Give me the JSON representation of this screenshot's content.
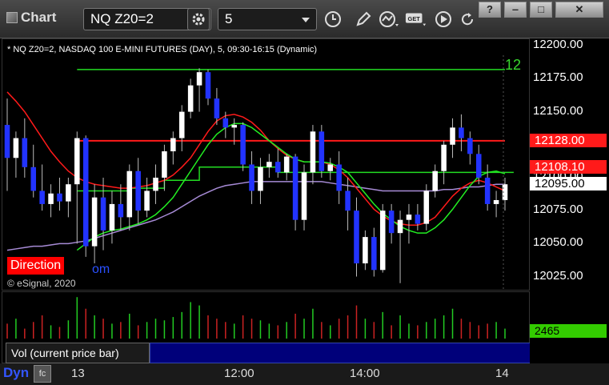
{
  "window": {
    "title": "Chart",
    "symbol_value": "NQ Z20=2",
    "interval_value": "5",
    "buttons": {
      "help": "?",
      "minimize": "‒",
      "maximize": "□",
      "close": "✕"
    }
  },
  "toolbar_icons": [
    "gear-icon",
    "clock-icon",
    "pencil-icon",
    "study-icon",
    "get-icon",
    "play-icon",
    "refresh-icon"
  ],
  "chart": {
    "info_line": "* NQ Z20=2, NASDAQ 100 E-MINI FUTURES (DAY), 5, 09:30-16:15 (Dynamic)",
    "copyright": "© eSignal, 2020",
    "direction_label": "Direction",
    "direction_tail": "om",
    "green_level_label": "12",
    "price_ticks": [
      "12200.00",
      "12175.00",
      "12150.00",
      "12125.00",
      "12100.00",
      "12075.00",
      "12050.00",
      "12025.00"
    ],
    "price_tags": [
      {
        "label": "12128.00",
        "color": "#ff1a1a"
      },
      {
        "label": "12108.10",
        "color": "#ff1a1a"
      },
      {
        "label": "12095.00",
        "color": "#ffffff"
      }
    ],
    "time_ticks": [
      "13",
      "12:00",
      "14:00",
      "14"
    ]
  },
  "volume": {
    "legend": "Vol (current price bar)",
    "close": "×",
    "value": "2465"
  },
  "bottom": {
    "dyn_label": "Dyn",
    "dyn_icon": "fc"
  },
  "chart_data": {
    "type": "candlestick",
    "ylim": [
      12015,
      12205
    ],
    "candles": [
      {
        "o": 12140,
        "h": 12160,
        "l": 12090,
        "c": 12115
      },
      {
        "o": 12115,
        "h": 12135,
        "l": 12100,
        "c": 12130
      },
      {
        "o": 12130,
        "h": 12145,
        "l": 12100,
        "c": 12108
      },
      {
        "o": 12108,
        "h": 12125,
        "l": 12085,
        "c": 12090
      },
      {
        "o": 12090,
        "h": 12110,
        "l": 12075,
        "c": 12080
      },
      {
        "o": 12080,
        "h": 12095,
        "l": 12070,
        "c": 12088
      },
      {
        "o": 12088,
        "h": 12100,
        "l": 12075,
        "c": 12082
      },
      {
        "o": 12082,
        "h": 12100,
        "l": 12070,
        "c": 12095
      },
      {
        "o": 12095,
        "h": 12135,
        "l": 12050,
        "c": 12130
      },
      {
        "o": 12130,
        "h": 12132,
        "l": 12040,
        "c": 12048
      },
      {
        "o": 12048,
        "h": 12095,
        "l": 12035,
        "c": 12085
      },
      {
        "o": 12085,
        "h": 12100,
        "l": 12045,
        "c": 12060
      },
      {
        "o": 12060,
        "h": 12090,
        "l": 12050,
        "c": 12080
      },
      {
        "o": 12080,
        "h": 12095,
        "l": 12060,
        "c": 12070
      },
      {
        "o": 12070,
        "h": 12110,
        "l": 12060,
        "c": 12105
      },
      {
        "o": 12105,
        "h": 12115,
        "l": 12065,
        "c": 12075
      },
      {
        "o": 12075,
        "h": 12100,
        "l": 12070,
        "c": 12090
      },
      {
        "o": 12090,
        "h": 12110,
        "l": 12080,
        "c": 12100
      },
      {
        "o": 12100,
        "h": 12125,
        "l": 12090,
        "c": 12120
      },
      {
        "o": 12120,
        "h": 12135,
        "l": 12110,
        "c": 12130
      },
      {
        "o": 12130,
        "h": 12155,
        "l": 12120,
        "c": 12150
      },
      {
        "o": 12150,
        "h": 12175,
        "l": 12145,
        "c": 12170
      },
      {
        "o": 12170,
        "h": 12183,
        "l": 12150,
        "c": 12180
      },
      {
        "o": 12180,
        "h": 12182,
        "l": 12155,
        "c": 12160
      },
      {
        "o": 12160,
        "h": 12168,
        "l": 12140,
        "c": 12145
      },
      {
        "o": 12145,
        "h": 12150,
        "l": 12130,
        "c": 12138
      },
      {
        "o": 12138,
        "h": 12145,
        "l": 12125,
        "c": 12140
      },
      {
        "o": 12140,
        "h": 12142,
        "l": 12105,
        "c": 12110
      },
      {
        "o": 12110,
        "h": 12120,
        "l": 12080,
        "c": 12090
      },
      {
        "o": 12090,
        "h": 12115,
        "l": 12080,
        "c": 12108
      },
      {
        "o": 12108,
        "h": 12118,
        "l": 12100,
        "c": 12112
      },
      {
        "o": 12112,
        "h": 12122,
        "l": 12100,
        "c": 12104
      },
      {
        "o": 12104,
        "h": 12118,
        "l": 12098,
        "c": 12116
      },
      {
        "o": 12116,
        "h": 12118,
        "l": 12060,
        "c": 12068
      },
      {
        "o": 12068,
        "h": 12110,
        "l": 12060,
        "c": 12104
      },
      {
        "o": 12104,
        "h": 12140,
        "l": 12095,
        "c": 12135
      },
      {
        "o": 12135,
        "h": 12140,
        "l": 12100,
        "c": 12105
      },
      {
        "o": 12105,
        "h": 12115,
        "l": 12098,
        "c": 12110
      },
      {
        "o": 12110,
        "h": 12120,
        "l": 12080,
        "c": 12090
      },
      {
        "o": 12090,
        "h": 12100,
        "l": 12060,
        "c": 12075
      },
      {
        "o": 12075,
        "h": 12085,
        "l": 12025,
        "c": 12035
      },
      {
        "o": 12035,
        "h": 12060,
        "l": 12030,
        "c": 12055
      },
      {
        "o": 12055,
        "h": 12062,
        "l": 12025,
        "c": 12030
      },
      {
        "o": 12030,
        "h": 12080,
        "l": 12028,
        "c": 12075
      },
      {
        "o": 12075,
        "h": 12080,
        "l": 12050,
        "c": 12058
      },
      {
        "o": 12058,
        "h": 12075,
        "l": 12020,
        "c": 12068
      },
      {
        "o": 12068,
        "h": 12080,
        "l": 12050,
        "c": 12072
      },
      {
        "o": 12072,
        "h": 12080,
        "l": 12060,
        "c": 12065
      },
      {
        "o": 12065,
        "h": 12095,
        "l": 12060,
        "c": 12090
      },
      {
        "o": 12090,
        "h": 12110,
        "l": 12085,
        "c": 12105
      },
      {
        "o": 12105,
        "h": 12128,
        "l": 12095,
        "c": 12125
      },
      {
        "o": 12125,
        "h": 12145,
        "l": 12115,
        "c": 12138
      },
      {
        "o": 12138,
        "h": 12148,
        "l": 12120,
        "c": 12130
      },
      {
        "o": 12130,
        "h": 12135,
        "l": 12110,
        "c": 12118
      },
      {
        "o": 12118,
        "h": 12125,
        "l": 12095,
        "c": 12100
      },
      {
        "o": 12100,
        "h": 12110,
        "l": 12075,
        "c": 12080
      },
      {
        "o": 12080,
        "h": 12090,
        "l": 12070,
        "c": 12083
      },
      {
        "o": 12083,
        "h": 12100,
        "l": 12075,
        "c": 12095
      }
    ],
    "red_ma": [
      12165,
      12158,
      12150,
      12140,
      12130,
      12120,
      12112,
      12105,
      12100,
      12097,
      12095,
      12094,
      12093,
      12092,
      12092,
      12093,
      12094,
      12096,
      12098,
      12102,
      12108,
      12115,
      12125,
      12135,
      12143,
      12147,
      12148,
      12146,
      12142,
      12136,
      12128,
      12122,
      12117,
      12114,
      12112,
      12112,
      12112,
      12110,
      12106,
      12100,
      12092,
      12084,
      12076,
      12071,
      12067,
      12065,
      12064,
      12064,
      12066,
      12070,
      12078,
      12086,
      12092,
      12096,
      12098,
      12096,
      12093,
      12090
    ],
    "green_ma": [
      null,
      null,
      null,
      null,
      null,
      null,
      null,
      null,
      12045,
      12050,
      12055,
      12058,
      12060,
      12061,
      12063,
      12065,
      12068,
      12072,
      12078,
      12085,
      12095,
      12105,
      12115,
      12125,
      12133,
      12138,
      12141,
      12141,
      12138,
      12133,
      12128,
      12123,
      12118,
      12114,
      12112,
      12112,
      12112,
      12111,
      12108,
      12104,
      12096,
      12088,
      12080,
      12073,
      12068,
      12063,
      12060,
      12058,
      12058,
      12062,
      12068,
      12076,
      12085,
      12094,
      12101,
      12104,
      12105,
      12103
    ],
    "purple_ma": [
      12045,
      12046,
      12047,
      12048,
      12048,
      12049,
      12050,
      12050,
      12051,
      12052,
      12054,
      12056,
      12058,
      12060,
      12062,
      12064,
      12066,
      12068,
      12071,
      12074,
      12078,
      12082,
      12086,
      12089,
      12092,
      12094,
      12095,
      12096,
      12097,
      12097,
      12097,
      12097,
      12097,
      12097,
      12097,
      12097,
      12097,
      12096,
      12095,
      12094,
      12093,
      12092,
      12091,
      12090,
      12090,
      12090,
      12090,
      12090,
      12090,
      12090,
      12091,
      12091,
      12092,
      12093,
      12093,
      12094,
      12095,
      12095
    ],
    "green_hline": {
      "value": 12182,
      "start_index": 8
    },
    "red_hline": {
      "value": 12128,
      "start_index": 8
    },
    "green_step": [
      {
        "from": 8,
        "to": 14,
        "value": 12090
      },
      {
        "from": 14,
        "to": 18,
        "value": 12092
      },
      {
        "from": 18,
        "to": 22,
        "value": 12098
      },
      {
        "from": 22,
        "to": 31,
        "value": 12108
      },
      {
        "from": 31,
        "to": 58,
        "value": 12104
      }
    ],
    "volume": [
      9,
      12,
      6,
      10,
      14,
      8,
      7,
      11,
      25,
      18,
      14,
      12,
      9,
      10,
      15,
      8,
      10,
      12,
      11,
      13,
      16,
      22,
      20,
      14,
      12,
      10,
      9,
      14,
      12,
      11,
      9,
      8,
      10,
      15,
      12,
      18,
      10,
      8,
      12,
      14,
      20,
      12,
      10,
      16,
      8,
      14,
      9,
      8,
      10,
      12,
      14,
      18,
      12,
      10,
      8,
      9,
      10,
      6
    ],
    "volume_ylim": [
      0,
      28
    ]
  }
}
